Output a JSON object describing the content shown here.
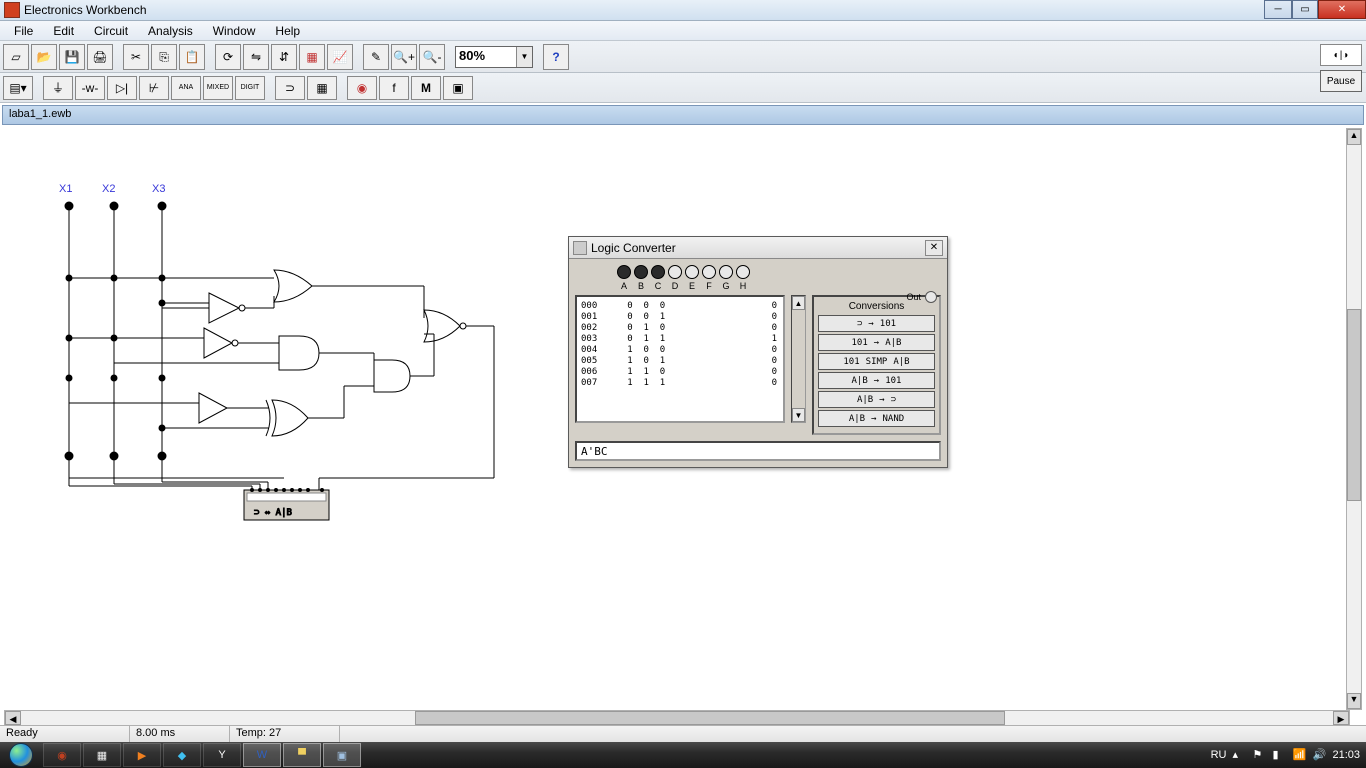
{
  "titlebar": {
    "app_name": "Electronics Workbench"
  },
  "menus": [
    "File",
    "Edit",
    "Circuit",
    "Analysis",
    "Window",
    "Help"
  ],
  "toolbar1_icons": [
    "new",
    "open",
    "save",
    "print",
    "cut",
    "copy",
    "paste",
    "rotate",
    "fliph",
    "flipv",
    "subckt",
    "graph",
    "probe",
    "zoom-in",
    "zoom-out"
  ],
  "zoom": {
    "value": "80%"
  },
  "help_icon": "?",
  "pause": {
    "label": "Pause"
  },
  "toolbar2_icons": [
    "select",
    "source",
    "resistor",
    "diode",
    "transistor",
    "analog",
    "mixed",
    "digital",
    "gate",
    "ic",
    "led",
    "freq",
    "M",
    "instrument"
  ],
  "document": {
    "filename": "laba1_1.ewb"
  },
  "circuit": {
    "inputs": [
      "X1",
      "X2",
      "X3"
    ]
  },
  "logic_converter": {
    "title": "Logic Converter",
    "input_labels": [
      "A",
      "B",
      "C",
      "D",
      "E",
      "F",
      "G",
      "H"
    ],
    "active_inputs": 3,
    "out_label": "Out",
    "rows": [
      {
        "idx": "000",
        "bits": "0  0  0",
        "out": "0"
      },
      {
        "idx": "001",
        "bits": "0  0  1",
        "out": "0"
      },
      {
        "idx": "002",
        "bits": "0  1  0",
        "out": "0"
      },
      {
        "idx": "003",
        "bits": "0  1  1",
        "out": "1"
      },
      {
        "idx": "004",
        "bits": "1  0  0",
        "out": "0"
      },
      {
        "idx": "005",
        "bits": "1  0  1",
        "out": "0"
      },
      {
        "idx": "006",
        "bits": "1  1  0",
        "out": "0"
      },
      {
        "idx": "007",
        "bits": "1  1  1",
        "out": "0"
      }
    ],
    "conversions_title": "Conversions",
    "buttons": [
      {
        "left": "⊃",
        "right": "101"
      },
      {
        "left": "101",
        "right": "A|B"
      },
      {
        "left": "101",
        "mid": "SIMP",
        "right": "A|B"
      },
      {
        "left": "A|B",
        "right": "101"
      },
      {
        "left": "A|B",
        "right": "⊃"
      },
      {
        "left": "A|B",
        "right": "NAND"
      }
    ],
    "expression": "A'BC"
  },
  "statusbar": {
    "ready": "Ready",
    "time": "8.00 ms",
    "temp": "Temp: 27"
  },
  "taskbar": {
    "lang": "RU",
    "clock": "21:03"
  }
}
